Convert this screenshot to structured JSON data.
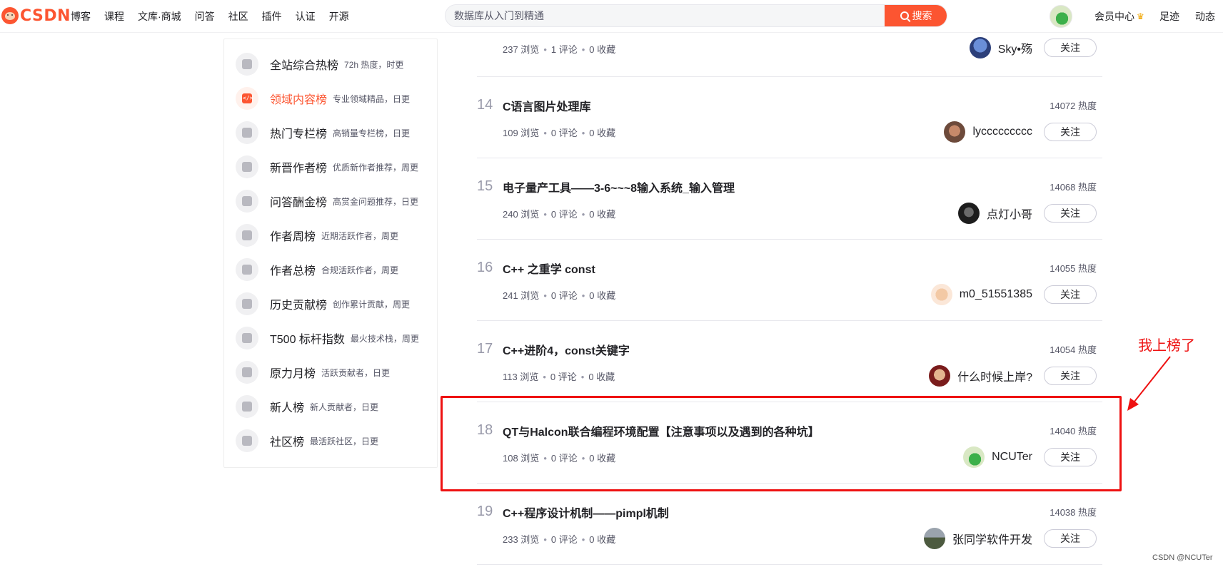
{
  "header": {
    "logo_text": "CSDN",
    "nav": [
      "博客",
      "课程",
      "文库·商城",
      "问答",
      "社区",
      "插件",
      "认证",
      "开源"
    ],
    "search_placeholder": "数据库从入门到精通",
    "search_button": "搜索",
    "right_links": [
      "会员中心",
      "足迹",
      "动态"
    ]
  },
  "sidebar": {
    "items": [
      {
        "label": "全站综合热榜",
        "sub": "72h 热度，时更",
        "icon": "rocket-icon",
        "active": false
      },
      {
        "label": "领域内容榜",
        "sub": "专业领域精品，日更",
        "icon": "code-icon",
        "active": true
      },
      {
        "label": "热门专栏榜",
        "sub": "高销量专栏榜，日更",
        "icon": "book-icon",
        "active": false
      },
      {
        "label": "新晋作者榜",
        "sub": "优质新作者推荐，周更",
        "icon": "user-icon",
        "active": false
      },
      {
        "label": "问答酬金榜",
        "sub": "高赏金问题推荐，日更",
        "icon": "question-icon",
        "active": false
      },
      {
        "label": "作者周榜",
        "sub": "近期活跃作者，周更",
        "icon": "calendar-icon",
        "active": false
      },
      {
        "label": "作者总榜",
        "sub": "合规活跃作者，周更",
        "icon": "users-icon",
        "active": false
      },
      {
        "label": "历史贡献榜",
        "sub": "创作累计贡献，周更",
        "icon": "camera-icon",
        "active": false
      },
      {
        "label": "T500 标杆指数",
        "sub": "最火技术栈，周更",
        "icon": "chart-icon",
        "active": false
      },
      {
        "label": "原力月榜",
        "sub": "活跃贡献者，日更",
        "icon": "power-icon",
        "active": false
      },
      {
        "label": "新人榜",
        "sub": "新人贡献者，日更",
        "icon": "sprout-icon",
        "active": false
      },
      {
        "label": "社区榜",
        "sub": "最活跃社区，日更",
        "icon": "community-icon",
        "active": false
      }
    ]
  },
  "ranking": {
    "top_partial": {
      "views": "237 浏览",
      "comments": "1 评论",
      "favorites": "0 收藏",
      "author": "Sky•殇",
      "follow": "关注"
    },
    "rows": [
      {
        "rank": "14",
        "title": "C语言图片处理库",
        "heat": "14072 热度",
        "views": "109 浏览",
        "comments": "0 评论",
        "favorites": "0 收藏",
        "author": "lyccccccccc",
        "follow": "关注"
      },
      {
        "rank": "15",
        "title": "电子量产工具——3-6~~~8输入系统_输入管理",
        "heat": "14068 热度",
        "views": "240 浏览",
        "comments": "0 评论",
        "favorites": "0 收藏",
        "author": "点灯小哥",
        "follow": "关注"
      },
      {
        "rank": "16",
        "title": "C++ 之重学 const",
        "heat": "14055 热度",
        "views": "241 浏览",
        "comments": "0 评论",
        "favorites": "0 收藏",
        "author": "m0_51551385",
        "follow": "关注"
      },
      {
        "rank": "17",
        "title": "C++进阶4，const关键字",
        "heat": "14054 热度",
        "views": "113 浏览",
        "comments": "0 评论",
        "favorites": "0 收藏",
        "author": "什么时候上岸?",
        "follow": "关注"
      },
      {
        "rank": "18",
        "title": "QT与Halcon联合编程环境配置【注意事项以及遇到的各种坑】",
        "heat": "14040 热度",
        "views": "108 浏览",
        "comments": "0 评论",
        "favorites": "0 收藏",
        "author": "NCUTer",
        "follow": "关注"
      },
      {
        "rank": "19",
        "title": "C++程序设计机制——pimpl机制",
        "heat": "14038 热度",
        "views": "233 浏览",
        "comments": "0 评论",
        "favorites": "0 收藏",
        "author": "张同学软件开发",
        "follow": "关注"
      }
    ]
  },
  "annotation": {
    "text": "我上榜了",
    "color": "#ee1111"
  },
  "watermark": "CSDN @NCUTer",
  "colors": {
    "accent": "#fc5531",
    "text": "#222226",
    "muted": "#555666"
  }
}
